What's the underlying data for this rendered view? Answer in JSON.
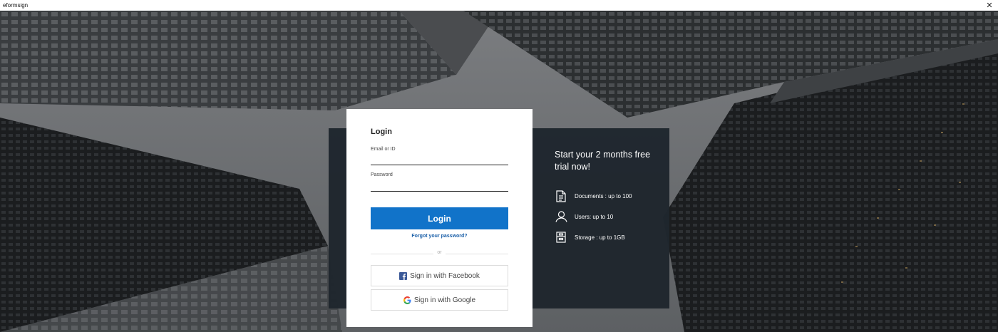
{
  "window": {
    "title": "eformsign",
    "close_icon": "close-icon",
    "close_glyph": "✕"
  },
  "login": {
    "title": "Login",
    "email_label": "Email or ID",
    "email_value": "",
    "password_label": "Password",
    "password_value": "",
    "login_button": "Login",
    "forgot_link": "Forgot your password?",
    "divider_text": "or",
    "facebook_button": "Sign in with Facebook",
    "google_button": "Sign in with Google"
  },
  "promo": {
    "title": "Start your 2 months free trial now!",
    "features": [
      {
        "icon": "document-icon",
        "label": "Documents : up to 100"
      },
      {
        "icon": "user-icon",
        "label": "Users: up to 10"
      },
      {
        "icon": "storage-icon",
        "label": "Storage : up to 1GB"
      }
    ]
  },
  "colors": {
    "primary": "#1173c9",
    "link": "#1a5fa8",
    "panel": "#1f262d",
    "facebook": "#3b5998"
  }
}
